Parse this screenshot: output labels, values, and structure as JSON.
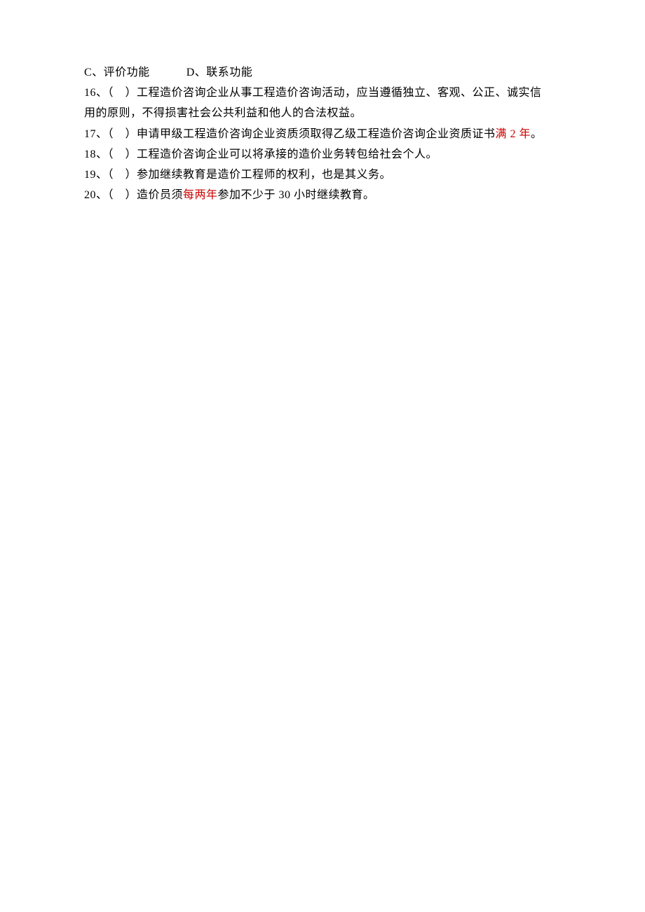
{
  "options": {
    "c": "C、评价功能",
    "d": "D、联系功能"
  },
  "q16": {
    "line1": "16、（　）工程造价咨询企业从事工程造价咨询活动，应当遵循独立、客观、公正、诚实信",
    "line2": "用的原则，不得损害社会公共利益和他人的合法权益。"
  },
  "q17": {
    "prefix": "17、（　）申请甲级工程造价咨询企业资质须取得乙级工程造价咨询企业资质证书",
    "highlight": "满 2 年",
    "suffix": "。"
  },
  "q18": "18、（　）工程造价咨询企业可以将承接的造价业务转包给社会个人。",
  "q19": "19、（　）参加继续教育是造价工程师的权利，也是其义务。",
  "q20": {
    "prefix": "20、（　）造价员须",
    "highlight": "每两年",
    "suffix": "参加不少于 30 小时继续教育。"
  }
}
